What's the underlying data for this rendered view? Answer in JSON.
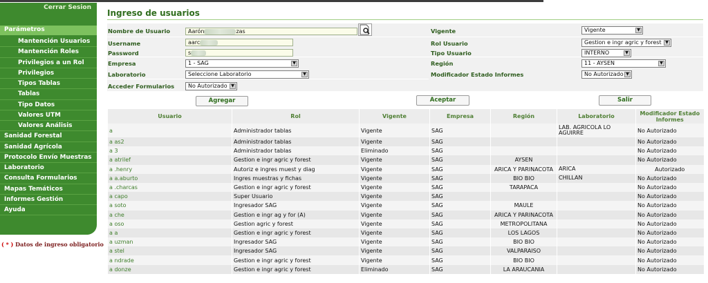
{
  "header": {
    "title": "Ingreso de usuarios",
    "close_session": "Cerrar Sesion"
  },
  "sidebar": {
    "section": "Parámetros",
    "items": [
      {
        "label": "Mantención Usuarios",
        "level": "sub"
      },
      {
        "label": "Mantención Roles",
        "level": "sub"
      },
      {
        "label": "Privilegios a un Rol",
        "level": "sub"
      },
      {
        "label": "Privilegios",
        "level": "sub"
      },
      {
        "label": "Tipos Tablas",
        "level": "sub"
      },
      {
        "label": "Tablas",
        "level": "sub"
      },
      {
        "label": "Tipo Datos",
        "level": "sub"
      },
      {
        "label": "Valores UTM",
        "level": "sub"
      },
      {
        "label": "Valores Análisis",
        "level": "sub"
      },
      {
        "label": "Sanidad Forestal",
        "level": "top"
      },
      {
        "label": "Sanidad Agrícola",
        "level": "top"
      },
      {
        "label": "Protocolo Envío Muestras",
        "level": "top"
      },
      {
        "label": "Laboratorio",
        "level": "top"
      },
      {
        "label": "Consulta Formularios",
        "level": "top"
      },
      {
        "label": "Mapas Temáticos",
        "level": "top"
      },
      {
        "label": "Informes Gestión",
        "level": "top"
      },
      {
        "label": "Ayuda",
        "level": "top"
      }
    ],
    "required_star": "( * )",
    "required_note": "Datos de ingreso obligatorio"
  },
  "form": {
    "nombre_label": "Nombre de Usuario",
    "nombre_value": "Aarón",
    "nombre_value_tail": "zas",
    "username_label": "Username",
    "username_value": "aarc",
    "password_label": "Password",
    "password_value": "s",
    "empresa_label": "Empresa",
    "empresa_value": "1 - SAG",
    "laboratorio_label": "Laboratorio",
    "laboratorio_value": "Seleccione Laboratorio",
    "acceder_label": "Acceder Formularios",
    "acceder_value": "No Autorizado",
    "vigente_label": "Vigente",
    "vigente_value": "Vigente",
    "rol_label": "Rol Usuario",
    "rol_value": "Gestion e ingr agric y forest",
    "tipo_label": "Tipo Usuario",
    "tipo_value": "INTERNO",
    "region_label": "Región",
    "region_value": "11 - AYSEN",
    "modificador_label": "Modificador Estado Informes",
    "modificador_value": "No Autorizado"
  },
  "buttons": {
    "agregar": "Agregar",
    "aceptar": "Aceptar",
    "salir": "Salir"
  },
  "table": {
    "columns": [
      "Usuario",
      "Rol",
      "Vigente",
      "Empresa",
      "Región",
      "Laboratorio",
      "Modificador Estado Informes"
    ],
    "rows": [
      {
        "usuario": "a",
        "rol": "Administrador tablas",
        "vigente": "Vigente",
        "empresa": "SAG",
        "region": "",
        "laboratorio": "LAB. AGRICOLA LO AGUIRRE",
        "modificador": "No Autorizado"
      },
      {
        "usuario": "a        as2",
        "rol": "Administrador tablas",
        "vigente": "Vigente",
        "empresa": "SAG",
        "region": "",
        "laboratorio": "",
        "modificador": "No Autorizado"
      },
      {
        "usuario": "a        3",
        "rol": "Administrador tablas",
        "vigente": "Eliminado",
        "empresa": "SAG",
        "region": "",
        "laboratorio": "",
        "modificador": "No Autorizado"
      },
      {
        "usuario": "a        atrilef",
        "rol": "Gestion e ingr agric y forest",
        "vigente": "Vigente",
        "empresa": "SAG",
        "region": "AYSEN",
        "laboratorio": "",
        "modificador": "No Autorizado"
      },
      {
        "usuario": "a        .henry",
        "rol": "Autoriz e ingres muest y diag",
        "vigente": "Vigente",
        "empresa": "SAG",
        "region": "ARICA Y PARINACOTA",
        "laboratorio": "ARICA",
        "modificador": "Autorizado"
      },
      {
        "usuario": "a        a.aburto",
        "rol": "Ingres muestras y fichas",
        "vigente": "Vigente",
        "empresa": "SAG",
        "region": "BIO BIO",
        "laboratorio": "CHILLAN",
        "modificador": "No Autorizado"
      },
      {
        "usuario": "a        .charcas",
        "rol": "Gestion e ingr agric y forest",
        "vigente": "Vigente",
        "empresa": "SAG",
        "region": "TARAPACA",
        "laboratorio": "",
        "modificador": "No Autorizado"
      },
      {
        "usuario": "a        capo",
        "rol": "Super Usuario",
        "vigente": "Vigente",
        "empresa": "SAG",
        "region": "",
        "laboratorio": "",
        "modificador": "No Autorizado"
      },
      {
        "usuario": "a        soto",
        "rol": "Ingresador SAG",
        "vigente": "Vigente",
        "empresa": "SAG",
        "region": "MAULE",
        "laboratorio": "",
        "modificador": "No Autorizado"
      },
      {
        "usuario": "a        che",
        "rol": "Gestion e ingr ag y for (A)",
        "vigente": "Vigente",
        "empresa": "SAG",
        "region": "ARICA Y PARINACOTA",
        "laboratorio": "",
        "modificador": "No Autorizado"
      },
      {
        "usuario": "a        oso",
        "rol": "Gestion agric y forest",
        "vigente": "Vigente",
        "empresa": "SAG",
        "region": "METROPOLITANA",
        "laboratorio": "",
        "modificador": "No Autorizado"
      },
      {
        "usuario": "a        a",
        "rol": "Gestion e ingr agric y forest",
        "vigente": "Vigente",
        "empresa": "SAG",
        "region": "LOS LAGOS",
        "laboratorio": "",
        "modificador": "No Autorizado"
      },
      {
        "usuario": "a        uzman",
        "rol": "Ingresador SAG",
        "vigente": "Vigente",
        "empresa": "SAG",
        "region": "BIO BIO",
        "laboratorio": "",
        "modificador": "No Autorizado"
      },
      {
        "usuario": "a        stel",
        "rol": "Ingresador SAG",
        "vigente": "Vigente",
        "empresa": "SAG",
        "region": "VALPARAISO",
        "laboratorio": "",
        "modificador": "No Autorizado"
      },
      {
        "usuario": "a        ndrade",
        "rol": "Gestion e ingr agric y forest",
        "vigente": "Vigente",
        "empresa": "SAG",
        "region": "BIO BIO",
        "laboratorio": "",
        "modificador": "No Autorizado"
      },
      {
        "usuario": "a        donze",
        "rol": "Gestion e ingr agric y forest",
        "vigente": "Eliminado",
        "empresa": "SAG",
        "region": "LA ARAUCANIA",
        "laboratorio": "",
        "modificador": "No Autorizado"
      }
    ]
  }
}
